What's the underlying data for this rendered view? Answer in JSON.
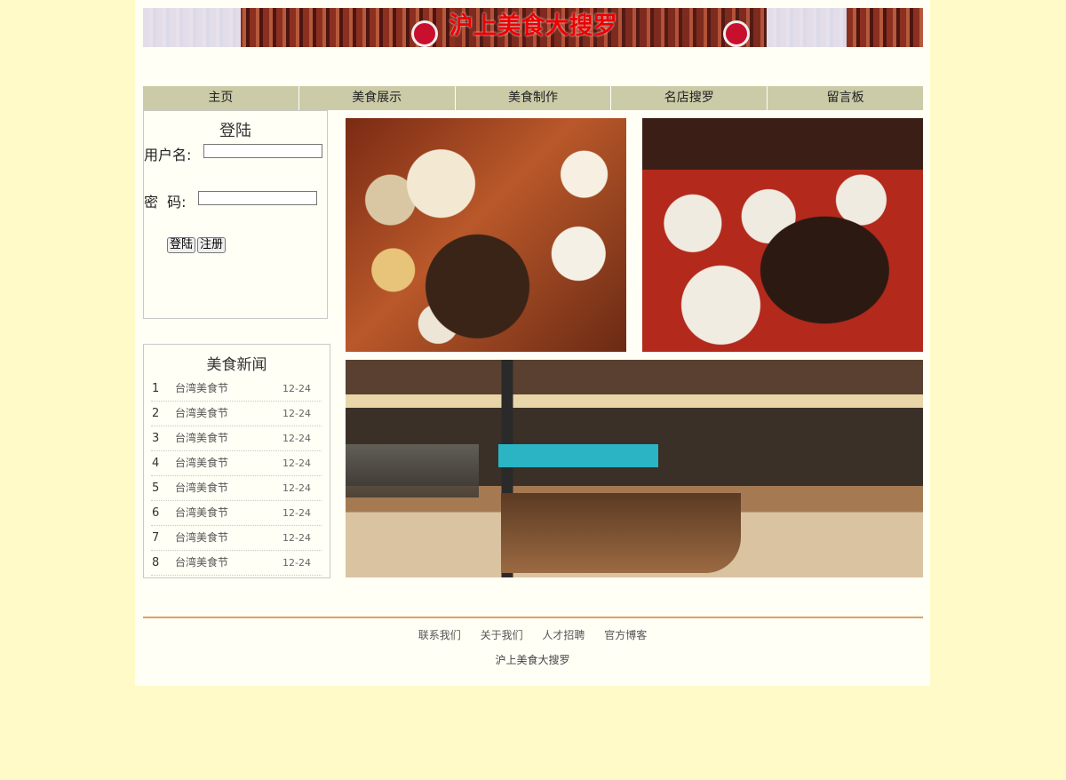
{
  "header": {
    "title": "沪上美食大搜罗"
  },
  "nav": [
    {
      "label": "主页"
    },
    {
      "label": "美食展示"
    },
    {
      "label": "美食制作"
    },
    {
      "label": "名店搜罗"
    },
    {
      "label": "留言板"
    }
  ],
  "login": {
    "title": "登陆",
    "username_label": "用户名:",
    "username_value": "",
    "password_label": "密  码:",
    "password_value": "",
    "login_button": "登陆",
    "register_button": "注册"
  },
  "news": {
    "title": "美食新闻",
    "items": [
      {
        "num": "1",
        "title": "台湾美食节",
        "date": "12-24"
      },
      {
        "num": "2",
        "title": "台湾美食节",
        "date": "12-24"
      },
      {
        "num": "3",
        "title": "台湾美食节",
        "date": "12-24"
      },
      {
        "num": "4",
        "title": "台湾美食节",
        "date": "12-24"
      },
      {
        "num": "5",
        "title": "台湾美食节",
        "date": "12-24"
      },
      {
        "num": "6",
        "title": "台湾美食节",
        "date": "12-24"
      },
      {
        "num": "7",
        "title": "台湾美食节",
        "date": "12-24"
      },
      {
        "num": "8",
        "title": "台湾美食节",
        "date": "12-24"
      }
    ]
  },
  "footer": {
    "links": [
      "联系我们",
      "关于我们",
      "人才招聘",
      "官方博客"
    ],
    "copyright": "沪上美食大搜罗"
  },
  "colors": {
    "page_bg": "#fffac8",
    "title_red": "#ee0000",
    "nav_bg": "#cbcba8",
    "footer_line": "#e0a060"
  }
}
